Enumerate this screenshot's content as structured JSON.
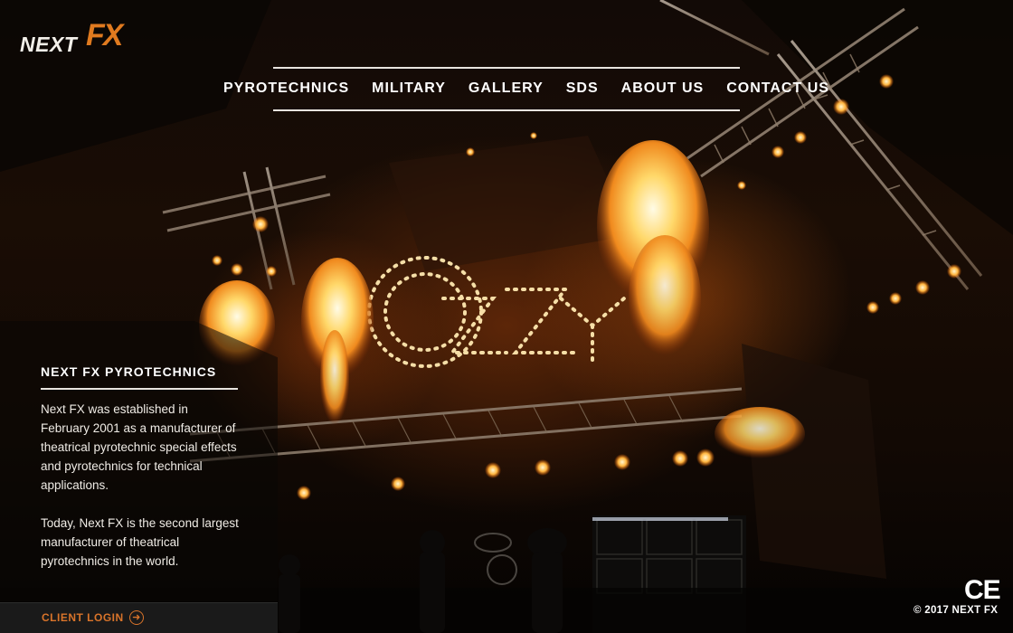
{
  "logo": {
    "word": "NEXT",
    "mark": "FX"
  },
  "nav": {
    "items": [
      {
        "label": "PYROTECHNICS"
      },
      {
        "label": "MILITARY"
      },
      {
        "label": "GALLERY"
      },
      {
        "label": "SDS"
      },
      {
        "label": "ABOUT US"
      },
      {
        "label": "CONTACT US"
      }
    ]
  },
  "intro": {
    "title": "NEXT FX PYROTECHNICS",
    "paragraph1": "Next FX was established in February 2001 as a manufacturer of theatrical pyrotechnic special effects and pyrotechnics for technical applications.",
    "paragraph2": "Today, Next FX is the second largest manufacturer of theatrical pyrotechnics in the world."
  },
  "client_login": {
    "label": "CLIENT LOGIN",
    "icon": "arrow-right-circle-icon"
  },
  "footer": {
    "certification": "CE",
    "copyright": "© 2017 NEXT FX"
  },
  "colors": {
    "accent": "#e07a1f",
    "login_text": "#d9742a",
    "panel_bg": "#1a1a1a",
    "text": "#ffffff"
  },
  "background": {
    "icon": "concert-stage-pyrotechnics-photo"
  }
}
